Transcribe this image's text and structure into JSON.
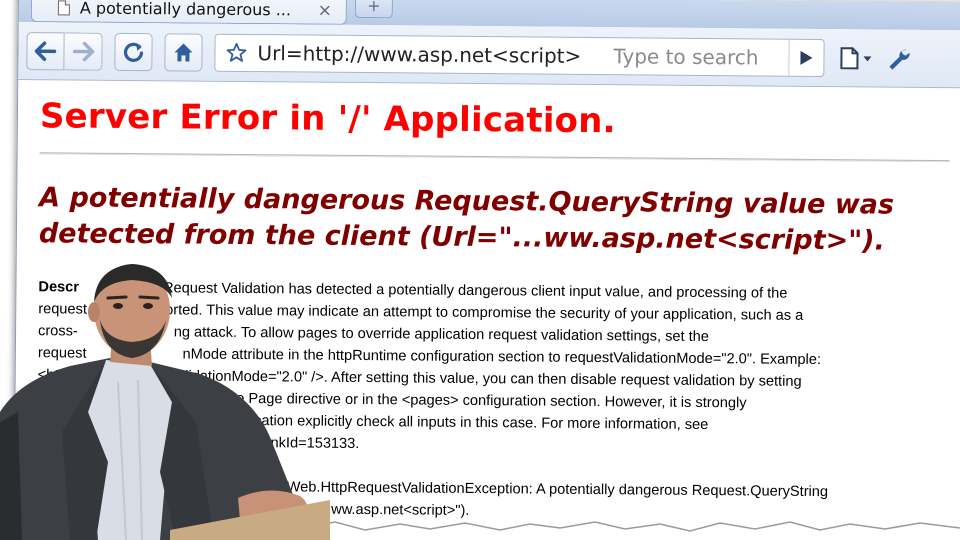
{
  "browser": {
    "tab": {
      "title": "A potentially dangerous ...",
      "close_label": "×",
      "new_tab_label": "+"
    },
    "toolbar": {
      "back_icon": "back-arrow-icon",
      "forward_icon": "forward-arrow-icon",
      "reload_icon": "reload-icon",
      "home_icon": "home-icon",
      "bookmark_icon": "star-icon",
      "url": "Url=http://www.asp.net<script>",
      "search_placeholder": "Type to search",
      "go_icon": "play-icon",
      "page_menu_icon": "page-menu-icon",
      "wrench_icon": "wrench-icon"
    }
  },
  "page": {
    "title": "Server Error in '/' Application.",
    "error_heading": "A potentially dangerous Request.QueryString value was detected from the client (Url=\"...ww.asp.net<script>\").",
    "description_label": "Descr",
    "description_lines": [
      "Request Validation has detected a potentially dangerous client input value, and processing of the",
      "aborted. This value may indicate an attempt to compromise the security of your application, such as a",
      "ng attack. To allow pages to override application request validation settings, set the",
      "nMode attribute in the httpRuntime configuration section to requestValidationMode=\"2.0\". Example:",
      "tValidationMode=\"2.0\" />. After setting this value, you can then disable request validation by setting",
      "\" in the Page directive or in the <pages> configuration section. However, it is strongly",
      "application explicitly check all inputs in this case. For more information, see",
      "link/?LinkId=153133."
    ],
    "line_prefixes": [
      "",
      "request",
      "cross-",
      "request",
      "<htt",
      "",
      "",
      ""
    ],
    "exception_lines": [
      "Web.HttpRequestValidationException: A potentially dangerous Request.QueryString",
      "Url=\"...ww.asp.net<script>\")."
    ],
    "exception_prefix": "m"
  },
  "colors": {
    "title_red": "#ff0000",
    "heading_maroon": "#800000",
    "chrome_blue": "#c7d6ee"
  }
}
